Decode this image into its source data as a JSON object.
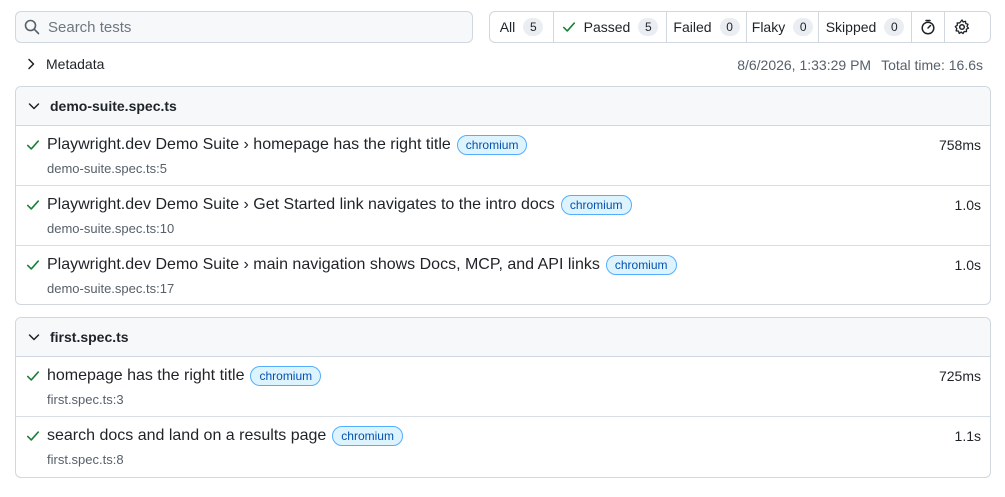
{
  "search": {
    "placeholder": "Search tests"
  },
  "filters": [
    {
      "label": "All",
      "count": "5"
    },
    {
      "label": "Passed",
      "count": "5"
    },
    {
      "label": "Failed",
      "count": "0"
    },
    {
      "label": "Flaky",
      "count": "0"
    },
    {
      "label": "Skipped",
      "count": "0"
    }
  ],
  "metadata": {
    "label": "Metadata",
    "datetime": "8/6/2026, 1:33:29 PM",
    "total_time": "Total time: 16.6s"
  },
  "suites": [
    {
      "name": "demo-suite.spec.ts",
      "tests": [
        {
          "title": "Playwright.dev Demo Suite › homepage has the right title",
          "project": "chromium",
          "file": "demo-suite.spec.ts:5",
          "duration": "758ms"
        },
        {
          "title": "Playwright.dev Demo Suite › Get Started link navigates to the intro docs",
          "project": "chromium",
          "file": "demo-suite.spec.ts:10",
          "duration": "1.0s"
        },
        {
          "title": "Playwright.dev Demo Suite › main navigation shows Docs, MCP, and API links",
          "project": "chromium",
          "file": "demo-suite.spec.ts:17",
          "duration": "1.0s"
        }
      ]
    },
    {
      "name": "first.spec.ts",
      "tests": [
        {
          "title": "homepage has the right title",
          "project": "chromium",
          "file": "first.spec.ts:3",
          "duration": "725ms"
        },
        {
          "title": "search docs and land on a results page",
          "project": "chromium",
          "file": "first.spec.ts:8",
          "duration": "1.1s"
        }
      ]
    }
  ],
  "colors": {
    "pass": "#1a7f37",
    "tag_text": "#0550ae",
    "tag_bg": "#ddf4ff"
  },
  "icons": {
    "search": "search-icon",
    "pass": "check-icon",
    "expand": "chevron-down-icon",
    "collapse": "chevron-right-icon",
    "timer": "stopwatch-icon",
    "settings": "gear-icon"
  }
}
